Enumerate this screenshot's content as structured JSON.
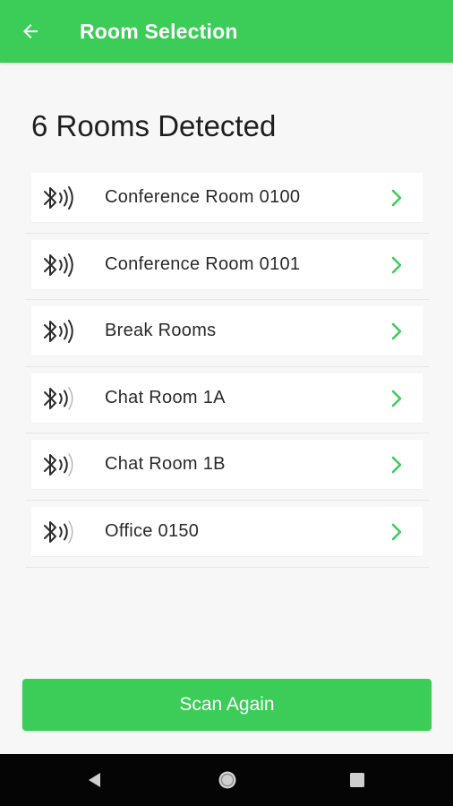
{
  "app_bar": {
    "title": "Room Selection",
    "background": "#3ccd59",
    "back_icon": "arrow-left-icon"
  },
  "heading": "6 Rooms Detected",
  "rooms": [
    {
      "name": "Conference Room 0100",
      "icon": "bluetooth-signal-icon",
      "signal_waves": 3
    },
    {
      "name": "Conference Room 0101",
      "icon": "bluetooth-signal-icon",
      "signal_waves": 3
    },
    {
      "name": "Break Rooms",
      "icon": "bluetooth-signal-icon",
      "signal_waves": 3
    },
    {
      "name": "Chat Room 1A",
      "icon": "bluetooth-signal-icon",
      "signal_waves": 2
    },
    {
      "name": "Chat Room 1B",
      "icon": "bluetooth-signal-icon",
      "signal_waves": 2
    },
    {
      "name": "Office 0150",
      "icon": "bluetooth-signal-icon",
      "signal_waves": 2
    }
  ],
  "chevron_color": "#3ccd59",
  "scan_button": {
    "label": "Scan Again",
    "background": "#3ccd59"
  },
  "system_nav": {
    "back_icon": "nav-back-icon",
    "home_icon": "nav-home-icon",
    "recents_icon": "nav-recents-icon"
  }
}
